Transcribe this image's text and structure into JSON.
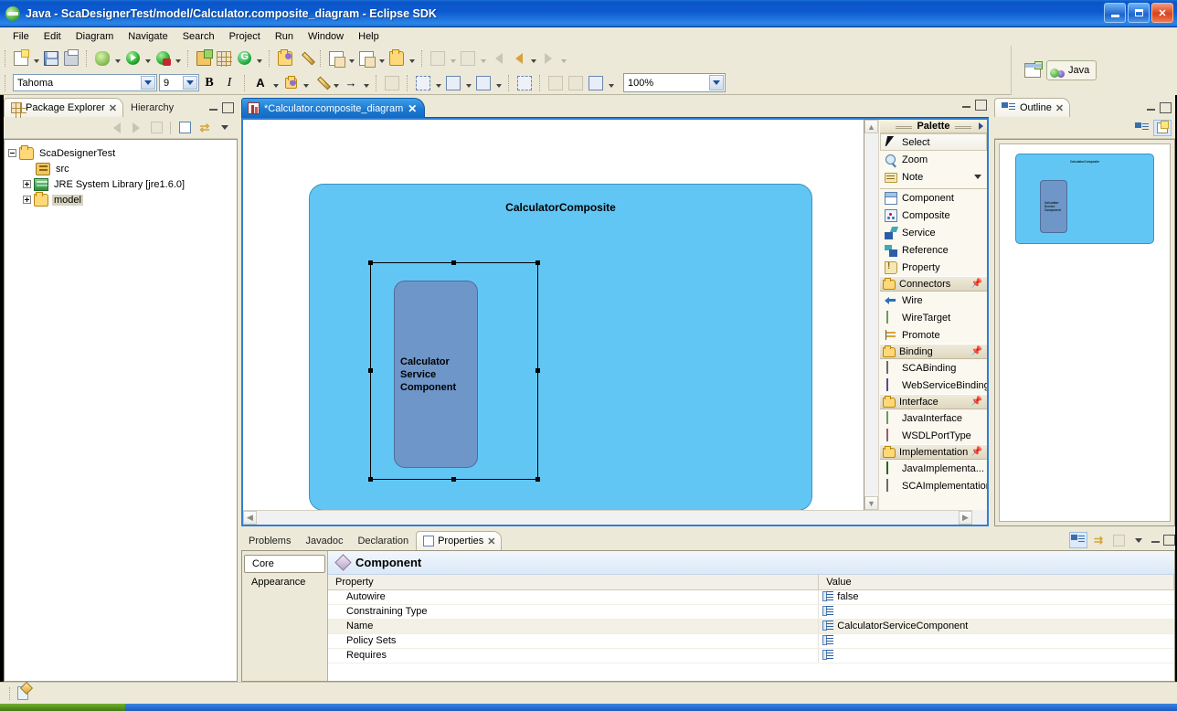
{
  "window": {
    "title": "Java - ScaDesignerTest/model/Calculator.composite_diagram - Eclipse SDK",
    "minimize_label": "Minimize",
    "maximize_label": "Restore",
    "close_label": "Close"
  },
  "menubar": {
    "items": [
      "File",
      "Edit",
      "Diagram",
      "Navigate",
      "Search",
      "Project",
      "Run",
      "Window",
      "Help"
    ]
  },
  "toolbar": {
    "font_family_value": "Tahoma",
    "font_size_value": "9",
    "bold_label": "B",
    "italic_label": "I",
    "zoom_value": "100%"
  },
  "perspective": {
    "open_perspective_label": "Open Perspective",
    "active_label": "Java"
  },
  "package_explorer": {
    "tabs": [
      {
        "label": "Package Explorer",
        "active": true,
        "closeable": true
      },
      {
        "label": "Hierarchy",
        "active": false,
        "closeable": false
      }
    ],
    "toolbar_icons": [
      "back-icon",
      "forward-icon",
      "up-icon",
      "collapse-all-icon",
      "link-with-editor-icon",
      "view-menu-icon"
    ],
    "tree": [
      {
        "label": "ScaDesignerTest",
        "level": 0,
        "icon": "project-icon",
        "expander": "minus",
        "selected": false
      },
      {
        "label": "src",
        "level": 1,
        "icon": "package-fragment-icon",
        "expander": "none",
        "selected": false
      },
      {
        "label": "JRE System Library [jre1.6.0]",
        "level": 1,
        "icon": "library-icon",
        "expander": "plus",
        "selected": false
      },
      {
        "label": "model",
        "level": 1,
        "icon": "folder-icon",
        "expander": "plus",
        "selected": true
      }
    ]
  },
  "editor": {
    "tab_label": "*Calculator.composite_diagram",
    "tab_close": "✕",
    "diagram": {
      "composite_name": "CalculatorComposite",
      "component_name": "Calculator\nService\nComponent",
      "composite_color": "#62c6f5",
      "component_color": "#6e96c8",
      "selection_handles": 8
    }
  },
  "palette": {
    "header": "Palette",
    "sections": [
      {
        "type": "tools",
        "items": [
          {
            "label": "Select",
            "icon": "cursor-icon",
            "selected": true
          },
          {
            "label": "Zoom",
            "icon": "zoom-icon",
            "selected": false
          },
          {
            "label": "Note",
            "icon": "note-icon",
            "selected": false,
            "has_menu": true
          }
        ]
      },
      {
        "type": "tools",
        "items": [
          {
            "label": "Component",
            "icon": "component-icon"
          },
          {
            "label": "Composite",
            "icon": "composite-icon"
          },
          {
            "label": "Service",
            "icon": "service-icon"
          },
          {
            "label": "Reference",
            "icon": "reference-icon"
          },
          {
            "label": "Property",
            "icon": "property-icon"
          }
        ]
      },
      {
        "type": "group",
        "group_label": "Connectors",
        "pinned": true,
        "items": [
          {
            "label": "Wire",
            "icon": "wire-icon"
          },
          {
            "label": "WireTarget",
            "icon": "diamond-green-icon"
          },
          {
            "label": "Promote",
            "icon": "promote-icon"
          }
        ]
      },
      {
        "type": "group",
        "group_label": "Binding",
        "pinned": true,
        "items": [
          {
            "label": "SCABinding",
            "icon": "diamond-gray-icon"
          },
          {
            "label": "WebServiceBinding",
            "icon": "diamond-purple-icon"
          }
        ]
      },
      {
        "type": "group",
        "group_label": "Interface",
        "pinned": true,
        "items": [
          {
            "label": "JavaInterface",
            "icon": "diamond-lightgreen-icon"
          },
          {
            "label": "WSDLPortType",
            "icon": "diamond-pink-icon"
          }
        ]
      },
      {
        "type": "group",
        "group_label": "Implementation",
        "pinned": true,
        "items": [
          {
            "label": "JavaImplementa...",
            "icon": "diamond-brightgreen-icon"
          },
          {
            "label": "SCAImplementation",
            "icon": "diamond-gray-icon"
          }
        ]
      }
    ]
  },
  "outline": {
    "tab_label": "Outline",
    "toolbar_icons": [
      "outline-tree-icon",
      "overview-icon"
    ],
    "thumbnail": {
      "composite_name": "CalculatorComposite",
      "component_name": "Calculator\nService\nComponent"
    }
  },
  "properties": {
    "tabs": [
      {
        "label": "Problems",
        "active": false
      },
      {
        "label": "Javadoc",
        "active": false
      },
      {
        "label": "Declaration",
        "active": false
      },
      {
        "label": "Properties",
        "active": true,
        "closeable": true
      }
    ],
    "side_tabs": [
      {
        "label": "Core",
        "active": true
      },
      {
        "label": "Appearance",
        "active": false
      }
    ],
    "section_title": "Component",
    "columns": [
      "Property",
      "Value"
    ],
    "rows": [
      {
        "property": "Autowire",
        "value": "false",
        "selected": false
      },
      {
        "property": "Constraining Type",
        "value": "",
        "selected": false
      },
      {
        "property": "Name",
        "value": "CalculatorServiceComponent",
        "selected": true
      },
      {
        "property": "Policy Sets",
        "value": "",
        "selected": false
      },
      {
        "property": "Requires",
        "value": "",
        "selected": false
      }
    ]
  },
  "statusbar": {
    "icon": "selection-status-icon",
    "text": ""
  }
}
